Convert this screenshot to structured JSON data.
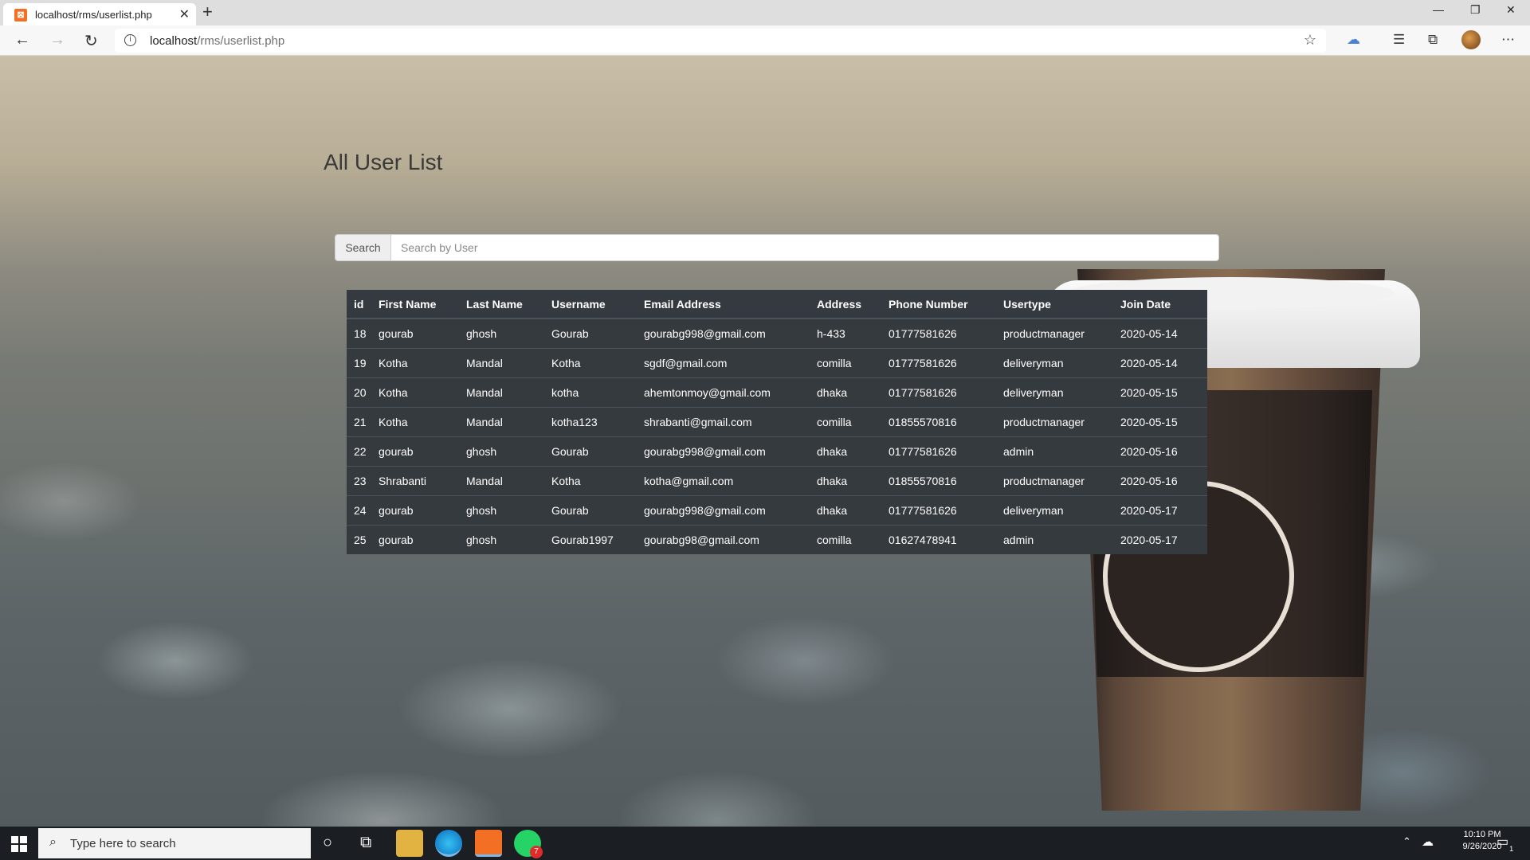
{
  "browser": {
    "tab_title": "localhost/rms/userlist.php",
    "url_host": "localhost",
    "url_path": "/rms/userlist.php"
  },
  "page": {
    "title": "All User List",
    "search_button": "Search",
    "search_placeholder": "Search by User"
  },
  "table": {
    "headers": [
      "id",
      "First Name",
      "Last Name",
      "Username",
      "Email Address",
      "Address",
      "Phone Number",
      "Usertype",
      "Join Date"
    ],
    "rows": [
      [
        "18",
        "gourab",
        "ghosh",
        "Gourab",
        "gourabg998@gmail.com",
        "h-433",
        "01777581626",
        "productmanager",
        "2020-05-14"
      ],
      [
        "19",
        "Kotha",
        "Mandal",
        "Kotha",
        "sgdf@gmail.com",
        "comilla",
        "01777581626",
        "deliveryman",
        "2020-05-14"
      ],
      [
        "20",
        "Kotha",
        "Mandal",
        "kotha",
        "ahemtonmoy@gmail.com",
        "dhaka",
        "01777581626",
        "deliveryman",
        "2020-05-15"
      ],
      [
        "21",
        "Kotha",
        "Mandal",
        "kotha123",
        "shrabanti@gmail.com",
        "comilla",
        "01855570816",
        "productmanager",
        "2020-05-15"
      ],
      [
        "22",
        "gourab",
        "ghosh",
        "Gourab",
        "gourabg998@gmail.com",
        "dhaka",
        "01777581626",
        "admin",
        "2020-05-16"
      ],
      [
        "23",
        "Shrabanti",
        "Mandal",
        "Kotha",
        "kotha@gmail.com",
        "dhaka",
        "01855570816",
        "productmanager",
        "2020-05-16"
      ],
      [
        "24",
        "gourab",
        "ghosh",
        "Gourab",
        "gourabg998@gmail.com",
        "dhaka",
        "01777581626",
        "deliveryman",
        "2020-05-17"
      ],
      [
        "25",
        "gourab",
        "ghosh",
        "Gourab1997",
        "gourabg98@gmail.com",
        "comilla",
        "01627478941",
        "admin",
        "2020-05-17"
      ]
    ]
  },
  "taskbar": {
    "search_text": "Type here to search",
    "time": "10:10 PM",
    "date": "9/26/2020",
    "notification_count": "1",
    "whatsapp_badge": "7"
  },
  "colors": {
    "table_bg": "#343a40",
    "taskbar_bg": "#1b1f24"
  }
}
